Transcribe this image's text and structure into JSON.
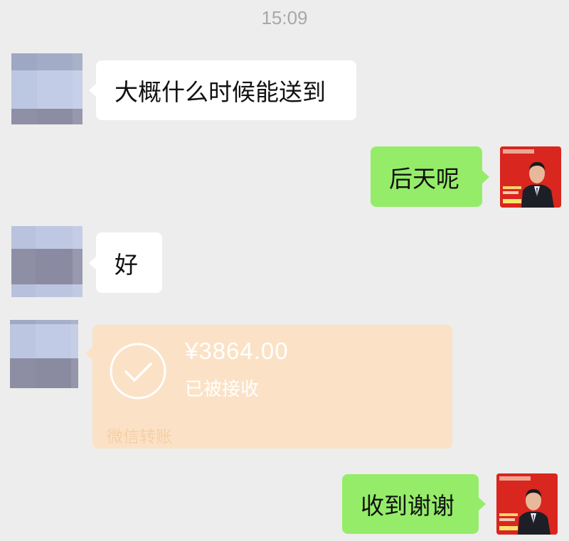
{
  "timestamp": "15:09",
  "messages": [
    {
      "sender": "peer",
      "text": "大概什么时候能送到"
    },
    {
      "sender": "self",
      "text": "后天呢"
    },
    {
      "sender": "peer",
      "text": "好"
    },
    {
      "sender": "self",
      "text": "收到谢谢"
    }
  ],
  "transfer": {
    "amount": "¥3864.00",
    "status": "已被接收",
    "source": "微信转账",
    "icon": "check-circle-icon"
  },
  "colors": {
    "background": "#ededed",
    "incoming_bubble": "#ffffff",
    "outgoing_bubble": "#95ec69",
    "transfer_card": "#fbe2c6"
  }
}
